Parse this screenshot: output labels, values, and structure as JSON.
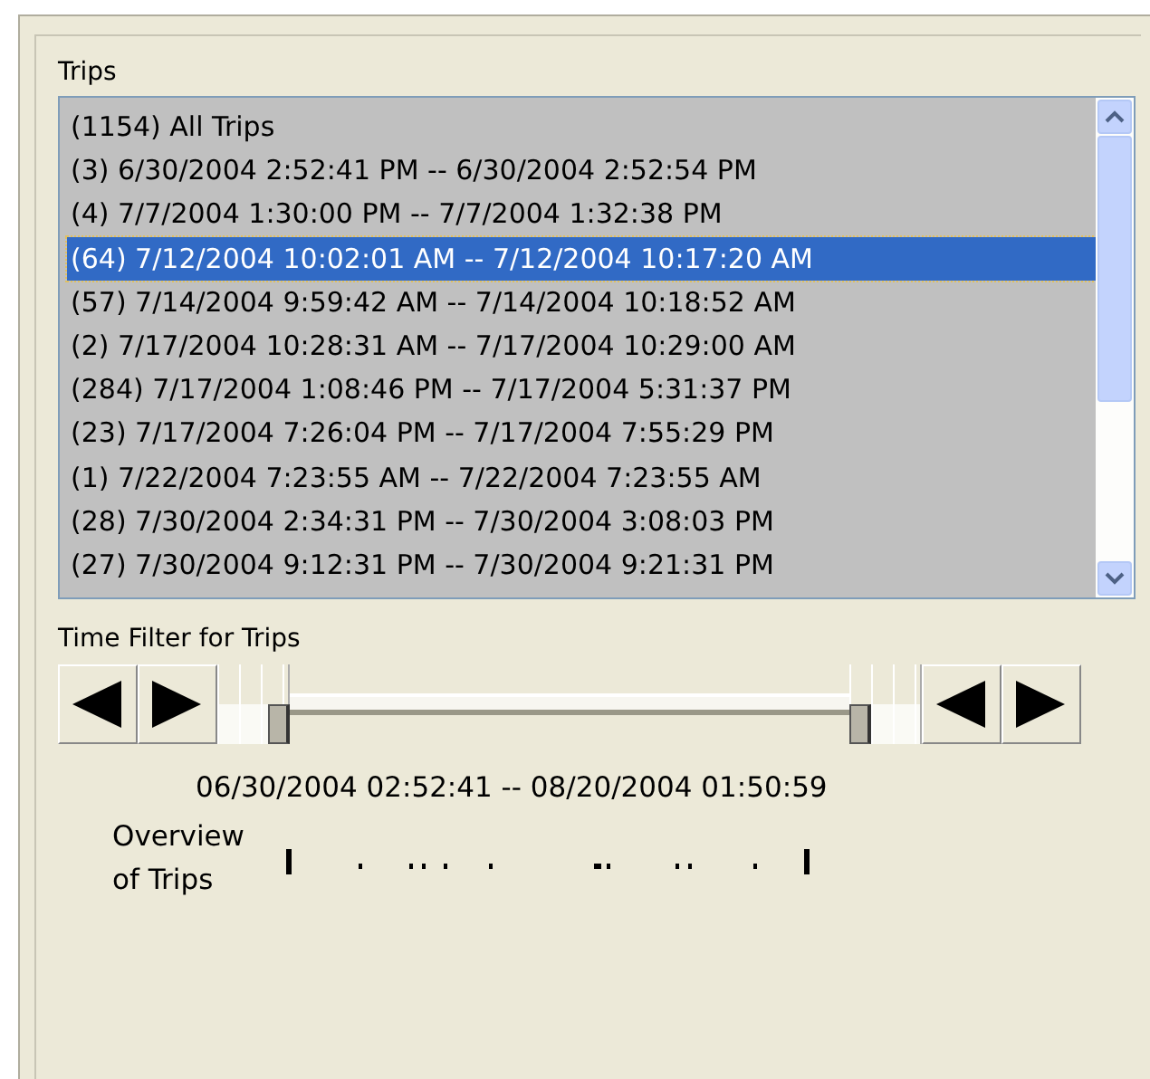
{
  "trips_group": {
    "title": "Trips",
    "trips": [
      {
        "label": "(1154) All Trips",
        "selected": false
      },
      {
        "label": "(3) 6/30/2004 2:52:41 PM -- 6/30/2004 2:52:54 PM",
        "selected": false
      },
      {
        "label": "(4) 7/7/2004 1:30:00 PM -- 7/7/2004 1:32:38 PM",
        "selected": false
      },
      {
        "label": "(64) 7/12/2004 10:02:01 AM -- 7/12/2004 10:17:20 AM",
        "selected": true
      },
      {
        "label": "(57) 7/14/2004 9:59:42 AM -- 7/14/2004 10:18:52 AM",
        "selected": false
      },
      {
        "label": "(2) 7/17/2004 10:28:31 AM -- 7/17/2004 10:29:00 AM",
        "selected": false
      },
      {
        "label": "(284) 7/17/2004 1:08:46 PM -- 7/17/2004 5:31:37 PM",
        "selected": false
      },
      {
        "label": "(23) 7/17/2004 7:26:04 PM -- 7/17/2004 7:55:29 PM",
        "selected": false
      },
      {
        "label": "(1) 7/22/2004 7:23:55 AM -- 7/22/2004 7:23:55 AM",
        "selected": false
      },
      {
        "label": "(28) 7/30/2004 2:34:31 PM -- 7/30/2004 3:08:03 PM",
        "selected": false
      },
      {
        "label": "(27) 7/30/2004 9:12:31 PM -- 7/30/2004 9:21:31 PM",
        "selected": false
      }
    ]
  },
  "time_filter": {
    "title": "Time Filter for Trips",
    "start_thumb": {
      "level": 0
    },
    "end_thumb": {
      "level": 1
    },
    "range_text": "06/30/2004 02:52:41 -- 08/20/2004 01:50:59",
    "overview_label": "Overview of Trips"
  }
}
